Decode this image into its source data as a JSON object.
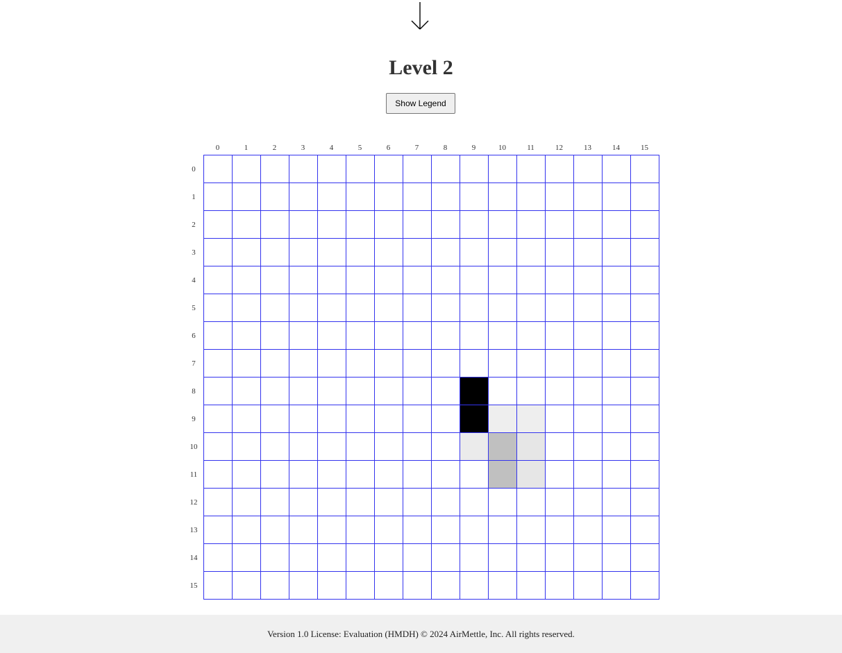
{
  "header": {
    "title": "Level 2",
    "legend_button_label": "Show Legend"
  },
  "grid": {
    "columns": [
      "0",
      "1",
      "2",
      "3",
      "4",
      "5",
      "6",
      "7",
      "8",
      "9",
      "10",
      "11",
      "12",
      "13",
      "14",
      "15"
    ],
    "rows": [
      "0",
      "1",
      "2",
      "3",
      "4",
      "5",
      "6",
      "7",
      "8",
      "9",
      "10",
      "11",
      "12",
      "13",
      "14",
      "15"
    ],
    "colors": {
      "empty": "#ffffff",
      "line": "#3333ee"
    },
    "cells": [
      {
        "row": 8,
        "col": 9,
        "color": "#000000"
      },
      {
        "row": 9,
        "col": 9,
        "color": "#000000"
      },
      {
        "row": 9,
        "col": 10,
        "color": "#eeeeee"
      },
      {
        "row": 9,
        "col": 11,
        "color": "#eeeeee"
      },
      {
        "row": 10,
        "col": 9,
        "color": "#ebebeb"
      },
      {
        "row": 10,
        "col": 10,
        "color": "#c0c0c0"
      },
      {
        "row": 10,
        "col": 11,
        "color": "#e6e6e6"
      },
      {
        "row": 11,
        "col": 10,
        "color": "#c0c0c0"
      },
      {
        "row": 11,
        "col": 11,
        "color": "#e6e6e6"
      }
    ]
  },
  "footer": {
    "text": "Version 1.0 License: Evaluation (HMDH) © 2024 AirMettle, Inc. All rights reserved."
  },
  "icons": {
    "top_arrow": "down-arrow-icon"
  }
}
